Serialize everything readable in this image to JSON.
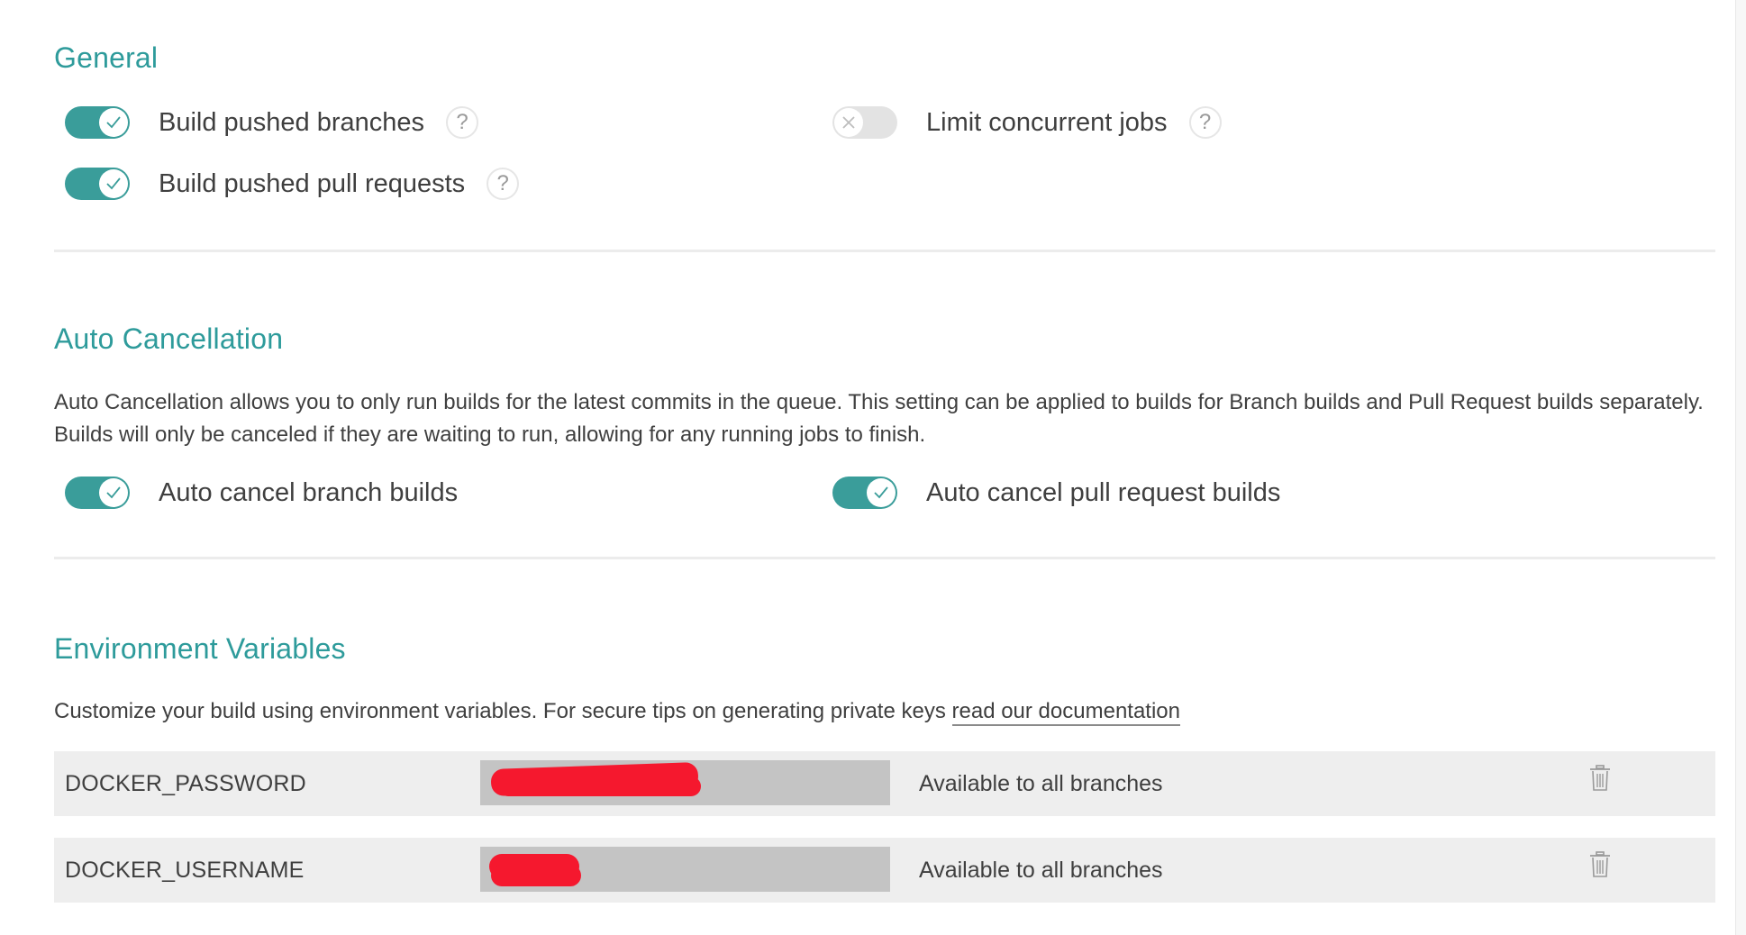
{
  "general": {
    "title": "General",
    "settings": [
      {
        "label": "Build pushed branches",
        "enabled": true,
        "has_help": true
      },
      {
        "label": "Build pushed pull requests",
        "enabled": true,
        "has_help": true
      },
      {
        "label": "Limit concurrent jobs",
        "enabled": false,
        "has_help": true
      }
    ],
    "help_glyph": "?"
  },
  "auto_cancellation": {
    "title": "Auto Cancellation",
    "description": "Auto Cancellation allows you to only run builds for the latest commits in the queue. This setting can be applied to builds for Branch builds and Pull Request builds separately. Builds will only be canceled if they are waiting to run, allowing for any running jobs to finish.",
    "settings": [
      {
        "label": "Auto cancel branch builds",
        "enabled": true
      },
      {
        "label": "Auto cancel pull request builds",
        "enabled": true
      }
    ]
  },
  "environment_variables": {
    "title": "Environment Variables",
    "description": "Customize your build using environment variables. For secure tips on generating private keys ",
    "link_text": "read our documentation",
    "variables": [
      {
        "name": "DOCKER_PASSWORD",
        "value_redacted": true,
        "availability": "Available to all branches"
      },
      {
        "name": "DOCKER_USERNAME",
        "value_redacted": true,
        "availability": "Available to all branches"
      }
    ]
  },
  "icons": {
    "toggle_on": "checkmark-icon",
    "toggle_off": "x-icon",
    "help": "question-mark-icon",
    "delete": "trash-icon"
  },
  "colors": {
    "accent": "#2e9b9b",
    "toggle_on": "#3a9d9a",
    "toggle_off": "#e3e3e3",
    "redaction": "#f5182e",
    "row_bg": "#eeeeee",
    "value_bg": "#c4c4c4"
  }
}
